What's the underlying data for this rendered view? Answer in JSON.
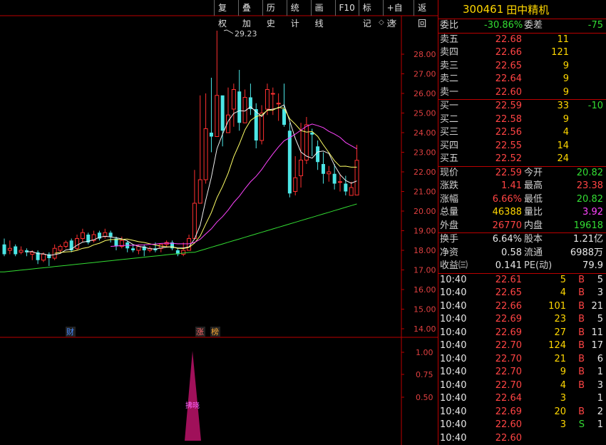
{
  "toolbar": [
    "复权",
    "叠加",
    "历史",
    "统计",
    "画线",
    "F10",
    "标记",
    "+自选",
    "返回"
  ],
  "stock": {
    "code": "300461",
    "name": "田中精机"
  },
  "chart_data": {
    "type": "candlestick",
    "y_ticks": [
      "28.00",
      "27.00",
      "26.00",
      "25.00",
      "24.00",
      "23.00",
      "22.00",
      "21.00",
      "20.00",
      "19.00",
      "18.00",
      "17.00",
      "16.00",
      "15.00",
      "14.00"
    ],
    "peak_label": "29.23",
    "markers": [
      "财",
      "涨",
      "榜"
    ],
    "indicator_ticks": [
      "1.00",
      "0.75",
      "0.50"
    ],
    "indicator_label": "拂晓"
  },
  "quote": {
    "webi": {
      "label": "委比",
      "value": "-30.86%",
      "label2": "委差",
      "value2": "-75"
    },
    "asks": [
      {
        "label": "卖五",
        "price": "22.68",
        "vol": "11"
      },
      {
        "label": "卖四",
        "price": "22.66",
        "vol": "121"
      },
      {
        "label": "卖三",
        "price": "22.65",
        "vol": "9"
      },
      {
        "label": "卖二",
        "price": "22.64",
        "vol": "9"
      },
      {
        "label": "卖一",
        "price": "22.60",
        "vol": "9"
      }
    ],
    "bids": [
      {
        "label": "买一",
        "price": "22.59",
        "vol": "33",
        "chg": "-10"
      },
      {
        "label": "买二",
        "price": "22.58",
        "vol": "9",
        "chg": ""
      },
      {
        "label": "买三",
        "price": "22.56",
        "vol": "4",
        "chg": ""
      },
      {
        "label": "买四",
        "price": "22.55",
        "vol": "14",
        "chg": ""
      },
      {
        "label": "买五",
        "price": "22.52",
        "vol": "24",
        "chg": ""
      }
    ],
    "stats": [
      {
        "l1": "现价",
        "v1": "22.59",
        "c1": "red",
        "l2": "今开",
        "v2": "20.82",
        "c2": "green"
      },
      {
        "l1": "涨跌",
        "v1": "1.41",
        "c1": "red",
        "l2": "最高",
        "v2": "23.38",
        "c2": "red"
      },
      {
        "l1": "涨幅",
        "v1": "6.66%",
        "c1": "red",
        "l2": "最低",
        "v2": "20.82",
        "c2": "green"
      },
      {
        "l1": "总量",
        "v1": "46388",
        "c1": "yellow",
        "l2": "量比",
        "v2": "3.92",
        "c2": "magenta"
      },
      {
        "l1": "外盘",
        "v1": "26770",
        "c1": "red",
        "l2": "内盘",
        "v2": "19618",
        "c2": "green"
      }
    ],
    "stats2": [
      {
        "l1": "换手",
        "v1": "6.64%",
        "l2": "股本",
        "v2": "1.21亿"
      },
      {
        "l1": "净资",
        "v1": "0.58",
        "l2": "流通",
        "v2": "6988万"
      },
      {
        "l1": "收益㈢",
        "v1": "0.141",
        "l2": "PE(动)",
        "v2": "79.9"
      }
    ],
    "ticks": [
      {
        "t": "10:40",
        "p": "22.61",
        "v": "5",
        "s": "B",
        "n": "5"
      },
      {
        "t": "10:40",
        "p": "22.65",
        "v": "4",
        "s": "B",
        "n": "3"
      },
      {
        "t": "10:40",
        "p": "22.66",
        "v": "101",
        "s": "B",
        "n": "21"
      },
      {
        "t": "10:40",
        "p": "22.69",
        "v": "23",
        "s": "B",
        "n": "5"
      },
      {
        "t": "10:40",
        "p": "22.69",
        "v": "27",
        "s": "B",
        "n": "11"
      },
      {
        "t": "10:40",
        "p": "22.70",
        "v": "124",
        "s": "B",
        "n": "17"
      },
      {
        "t": "10:40",
        "p": "22.70",
        "v": "21",
        "s": "B",
        "n": "6"
      },
      {
        "t": "10:40",
        "p": "22.70",
        "v": "9",
        "s": "B",
        "n": "1"
      },
      {
        "t": "10:40",
        "p": "22.70",
        "v": "4",
        "s": "B",
        "n": "3"
      },
      {
        "t": "10:40",
        "p": "22.64",
        "v": "3",
        "s": "",
        "n": "1"
      },
      {
        "t": "10:40",
        "p": "22.69",
        "v": "20",
        "s": "B",
        "n": "2"
      },
      {
        "t": "10:40",
        "p": "22.60",
        "v": "3",
        "s": "S",
        "n": "1"
      },
      {
        "t": "10:40",
        "p": "22.60",
        "v": "",
        "s": "",
        "n": ""
      }
    ]
  }
}
